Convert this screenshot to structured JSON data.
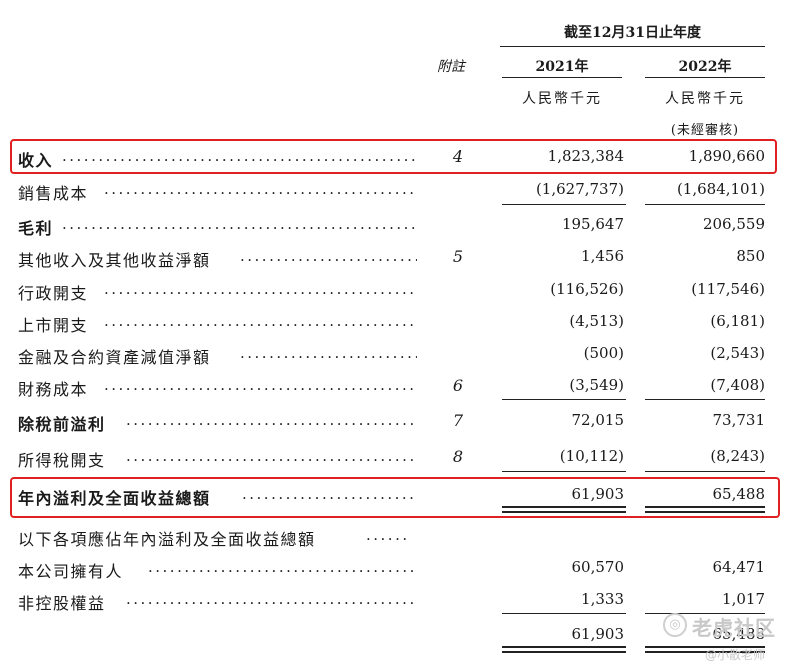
{
  "header": {
    "period": "截至12月31日止年度",
    "note_label": "附註",
    "year1": "2021年",
    "year2": "2022年",
    "unit1": "人民幣千元",
    "unit2": "人民幣千元",
    "unaudited": "(未經審核)"
  },
  "rows": [
    {
      "label": "收入",
      "note": "4",
      "v2021": "1,823,384",
      "v2022": "1,890,660"
    },
    {
      "label": "銷售成本",
      "note": "",
      "v2021": "(1,627,737)",
      "v2022": "(1,684,101)"
    },
    {
      "label": "毛利",
      "note": "",
      "v2021": "195,647",
      "v2022": "206,559"
    },
    {
      "label": "其他收入及其他收益淨額",
      "note": "5",
      "v2021": "1,456",
      "v2022": "850"
    },
    {
      "label": "行政開支",
      "note": "",
      "v2021": "(116,526)",
      "v2022": "(117,546)"
    },
    {
      "label": "上市開支",
      "note": "",
      "v2021": "(4,513)",
      "v2022": "(6,181)"
    },
    {
      "label": "金融及合約資產減值淨額",
      "note": "",
      "v2021": "(500)",
      "v2022": "(2,543)"
    },
    {
      "label": "財務成本",
      "note": "6",
      "v2021": "(3,549)",
      "v2022": "(7,408)"
    },
    {
      "label": "除稅前溢利",
      "note": "7",
      "v2021": "72,015",
      "v2022": "73,731"
    },
    {
      "label": "所得稅開支",
      "note": "8",
      "v2021": "(10,112)",
      "v2022": "(8,243)"
    },
    {
      "label": "年內溢利及全面收益總額",
      "note": "",
      "v2021": "61,903",
      "v2022": "65,488"
    },
    {
      "label": "以下各項應佔年內溢利及全面收益總額",
      "note": "",
      "v2021": "",
      "v2022": ""
    },
    {
      "label": "本公司擁有人",
      "note": "",
      "v2021": "60,570",
      "v2022": "64,471"
    },
    {
      "label": "非控股權益",
      "note": "",
      "v2021": "1,333",
      "v2022": "1,017"
    },
    {
      "label": "",
      "note": "",
      "v2021": "61,903",
      "v2022": "65,488"
    }
  ],
  "watermark": {
    "brand": "老虎社区",
    "handle": "@小散老师"
  },
  "colors": {
    "highlight_box": "#e02020",
    "text": "#1a1a1a"
  }
}
